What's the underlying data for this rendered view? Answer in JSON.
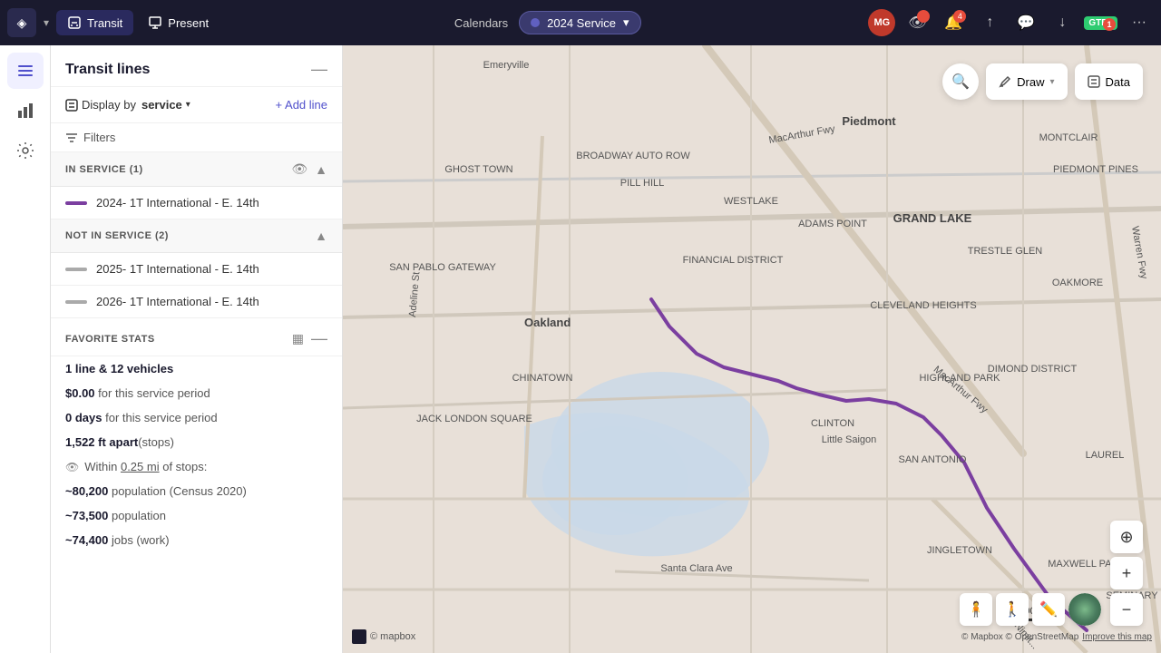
{
  "app": {
    "logo_text": "◈",
    "nav": {
      "transit_label": "Transit",
      "present_label": "Present"
    },
    "calendars_label": "Calendars",
    "service_pill": {
      "label": "2024 Service",
      "chevron": "▾"
    },
    "topbar_icons": {
      "eye": "👁",
      "bell_badge": "4",
      "share": "↑",
      "chat": "💬",
      "download": "↓",
      "gtfs_label": "GTFS",
      "gtfs_badge": "1",
      "more": "···"
    },
    "avatar": "MG"
  },
  "sidebar": {
    "title": "Transit lines",
    "display_by_label": "Display by",
    "display_by_value": "service",
    "add_line_label": "+ Add line",
    "filters_label": "Filters",
    "sections": {
      "in_service": {
        "title": "IN SERVICE (1)",
        "routes": [
          {
            "name": "2024- 1T International - E. 14th",
            "color": "#7b3fa0"
          }
        ]
      },
      "not_in_service": {
        "title": "NOT IN SERVICE (2)",
        "routes": [
          {
            "name": "2025- 1T International - E. 14th",
            "color": "#aaaaaa"
          },
          {
            "name": "2026- 1T International - E. 14th",
            "color": "#aaaaaa"
          }
        ]
      }
    },
    "fav_stats": {
      "title": "FAVORITE STATS",
      "stats": [
        {
          "bold": "1 line & 12 vehicles",
          "rest": ""
        },
        {
          "bold": "$0.00",
          "rest": " for this service period"
        },
        {
          "bold": "0 days",
          "rest": " for this service period"
        },
        {
          "bold": "1,522 ft apart",
          "rest": "(stops)"
        }
      ],
      "visibility_label": "Within 0.25 mi of stops:",
      "pop_stats": [
        {
          "bold": "~80,200",
          "rest": " population (Census 2020)"
        },
        {
          "bold": "~73,500",
          "rest": " population"
        },
        {
          "bold": "~74,400",
          "rest": " jobs (work)"
        }
      ]
    }
  },
  "map": {
    "scale_label": "3000 ft",
    "labels": [
      "Emeryville",
      "Piedmont",
      "MONTCLAIR",
      "PIEDMONT PINES",
      "BROADWAY AUTO ROW",
      "FINANCIAL DISTRICT",
      "ADAMS POINT",
      "GRAND LAKE",
      "TRESTLE GLEN",
      "OAKMORE",
      "SAN PABLO GATEWAY",
      "Oakland",
      "CHINATOWN",
      "CLEVELAND HEIGHTS",
      "DIMOND DISTRICT",
      "HIGHLAND PARK",
      "JACK LONDON SQUARE",
      "GHOST TOWN",
      "PILL HILL",
      "WESTLAKE",
      "CLINTON",
      "Little Saigon",
      "SAN ANTONIO",
      "LAUREL",
      "JINGLETOWN",
      "MAXWELL PARK",
      "SEMINARY",
      "Santa Clara Ave",
      "MacArthur Fwy",
      "Adeline St",
      "Warren Fwy",
      "Nimit..."
    ],
    "attribution": "© Mapbox © OpenStreetMap",
    "improve_link": "Improve this map"
  },
  "strip_icons": {
    "layers": "≡",
    "chart": "▦",
    "settings": "⚙"
  }
}
